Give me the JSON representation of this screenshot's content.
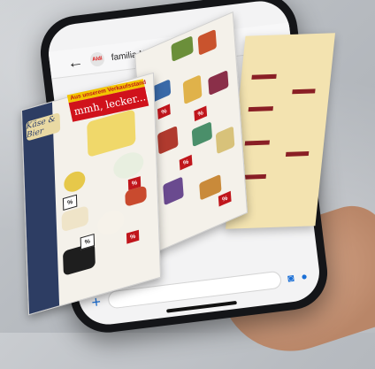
{
  "chat": {
    "title": "familia Nontost",
    "avatar_text": "Aldi"
  },
  "flyer": {
    "logo": "Käse & Bier",
    "banner_top": "Aus unserem Verkaufsstand",
    "banner_main": "mmh, lecker...!",
    "price_symbol": "%"
  },
  "icons": {
    "back": "back-arrow-icon",
    "plus": "plus-icon",
    "camera": "camera-icon",
    "mic": "microphone-icon"
  },
  "colors": {
    "brand_red": "#d0121b",
    "banner_yellow": "#f2c400",
    "strip_blue": "#2d3d63",
    "link_blue": "#1a6fd6"
  }
}
